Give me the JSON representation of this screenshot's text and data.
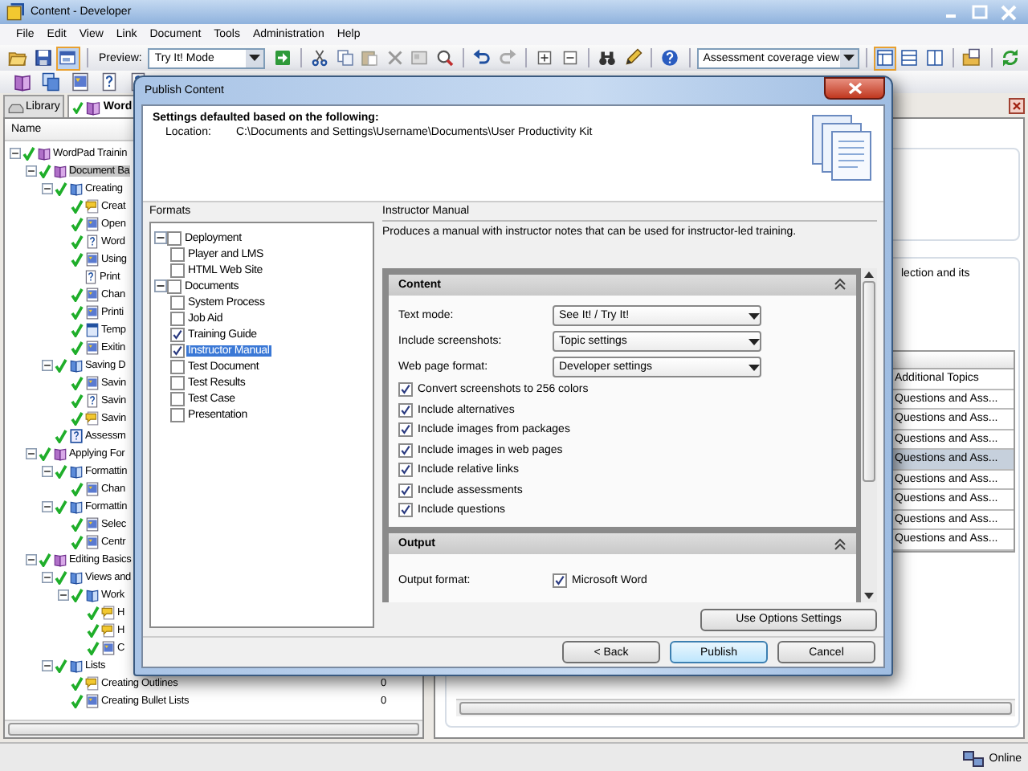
{
  "window": {
    "title": "Content - Developer"
  },
  "menu": [
    {
      "label": "File"
    },
    {
      "label": "Edit"
    },
    {
      "label": "View"
    },
    {
      "label": "Link"
    },
    {
      "label": "Document"
    },
    {
      "label": "Tools"
    },
    {
      "label": "Administration"
    },
    {
      "label": "Help"
    }
  ],
  "toolbar": {
    "file_buttons": [
      {
        "kind": "open",
        "pressed": false
      },
      {
        "kind": "save",
        "pressed": false
      },
      {
        "kind": "publish",
        "pressed": true
      }
    ],
    "preview": {
      "label": "Preview:",
      "value": "Try It! Mode"
    },
    "tool_groups": [
      [
        {
          "kind": "go",
          "pressed": false
        }
      ],
      [
        {
          "kind": "cut",
          "pressed": false
        },
        {
          "kind": "copy",
          "pressed": false
        },
        {
          "kind": "paste",
          "pressed": false
        },
        {
          "kind": "del",
          "pressed": false
        },
        {
          "kind": "props",
          "pressed": false
        },
        {
          "kind": "find",
          "pressed": false
        }
      ],
      [
        {
          "kind": "undo",
          "pressed": false
        },
        {
          "kind": "redo",
          "pressed": false
        }
      ],
      [
        {
          "kind": "plus",
          "pressed": false
        },
        {
          "kind": "minus",
          "pressed": false
        }
      ],
      [
        {
          "kind": "binoc",
          "pressed": false
        },
        {
          "kind": "spell",
          "pressed": false
        }
      ],
      [
        {
          "kind": "help",
          "pressed": false
        }
      ]
    ],
    "view_select": "Assessment coverage view",
    "view_groups": [
      [
        {
          "kind": "v1",
          "pressed": true
        },
        {
          "kind": "v2",
          "pressed": false
        },
        {
          "kind": "v3",
          "pressed": false
        }
      ],
      [
        {
          "kind": "props2",
          "pressed": false
        }
      ],
      [
        {
          "kind": "refresh",
          "pressed": false
        }
      ]
    ]
  },
  "toolbar2": [
    {
      "kind": "module"
    },
    {
      "kind": "stack"
    },
    {
      "kind": "screen"
    },
    {
      "kind": "question"
    },
    {
      "kind": "question"
    }
  ],
  "tabs": [
    {
      "label": "Library",
      "kind": "library",
      "selected": false
    },
    {
      "label": "Word",
      "kind": "document",
      "selected": true
    }
  ],
  "library": {
    "column": "Name",
    "tree": [
      {
        "label": "WordPad Trainin",
        "kind": "module",
        "checked": true,
        "selected": false,
        "expanded": true,
        "children": [
          {
            "label": "Document Ba",
            "kind": "module",
            "checked": true,
            "selected": true,
            "expanded": true,
            "children": [
              {
                "label": "Creating",
                "kind": "section",
                "checked": true,
                "selected": false,
                "expanded": true,
                "children": [
                  {
                    "label": "Creat",
                    "kind": "topic",
                    "checked": true,
                    "selected": false
                  },
                  {
                    "label": "Open",
                    "kind": "screen",
                    "checked": true,
                    "selected": false
                  },
                  {
                    "label": "Word",
                    "kind": "question",
                    "checked": true,
                    "selected": false
                  },
                  {
                    "label": "Using",
                    "kind": "screen",
                    "checked": true,
                    "selected": false
                  },
                  {
                    "label": "Print",
                    "kind": "question",
                    "checked": false,
                    "selected": false
                  },
                  {
                    "label": "Chan",
                    "kind": "screen",
                    "checked": true,
                    "selected": false
                  },
                  {
                    "label": "Printi",
                    "kind": "screen",
                    "checked": true,
                    "selected": false
                  },
                  {
                    "label": "Temp",
                    "kind": "web",
                    "checked": true,
                    "selected": false
                  },
                  {
                    "label": "Exitin",
                    "kind": "screen",
                    "checked": true,
                    "selected": false
                  }
                ]
              },
              {
                "label": "Saving D",
                "kind": "section",
                "checked": true,
                "selected": false,
                "expanded": true,
                "children": [
                  {
                    "label": "Savin",
                    "kind": "screen",
                    "checked": true,
                    "selected": false
                  },
                  {
                    "label": "Savin",
                    "kind": "question",
                    "checked": true,
                    "selected": false
                  },
                  {
                    "label": "Savin",
                    "kind": "topic",
                    "checked": true,
                    "selected": false
                  }
                ]
              },
              {
                "label": "Assessm",
                "kind": "assessment",
                "checked": true,
                "selected": false
              }
            ]
          },
          {
            "label": "Applying For",
            "kind": "module",
            "checked": true,
            "selected": false,
            "expanded": true,
            "children": [
              {
                "label": "Formattin",
                "kind": "section",
                "checked": true,
                "selected": false,
                "expanded": true,
                "children": [
                  {
                    "label": "Chan",
                    "kind": "screen",
                    "checked": true,
                    "selected": false
                  }
                ]
              },
              {
                "label": "Formattin",
                "kind": "section",
                "checked": true,
                "selected": false,
                "expanded": true,
                "children": [
                  {
                    "label": "Selec",
                    "kind": "screen",
                    "checked": true,
                    "selected": false
                  },
                  {
                    "label": "Centr",
                    "kind": "screen",
                    "checked": true,
                    "selected": false
                  }
                ]
              }
            ]
          },
          {
            "label": "Editing Basics",
            "kind": "module",
            "checked": true,
            "selected": false,
            "expanded": true,
            "children": [
              {
                "label": "Views and",
                "kind": "section",
                "checked": true,
                "selected": false,
                "expanded": true,
                "children": [
                  {
                    "label": "Work",
                    "kind": "section",
                    "checked": true,
                    "selected": false,
                    "expanded": true,
                    "children": [
                      {
                        "label": "H",
                        "kind": "topic",
                        "checked": true,
                        "selected": false
                      },
                      {
                        "label": "H",
                        "kind": "topic",
                        "checked": true,
                        "selected": false
                      },
                      {
                        "label": "C",
                        "kind": "screen",
                        "checked": true,
                        "selected": false
                      }
                    ]
                  }
                ]
              },
              {
                "label": "Lists",
                "kind": "section",
                "checked": true,
                "selected": false,
                "expanded": true,
                "children": [
                  {
                    "label": "Creating Outlines",
                    "kind": "topic",
                    "checked": true,
                    "selected": false,
                    "count": "0"
                  },
                  {
                    "label": "Creating Bullet Lists",
                    "kind": "screen",
                    "checked": true,
                    "selected": false,
                    "count": "0"
                  }
                ]
              }
            ]
          }
        ]
      }
    ]
  },
  "details": {
    "text": "lection and its",
    "column_header": "Additional Topics",
    "rows": [
      {
        "cell": "Questions and Ass...",
        "selected": false
      },
      {
        "cell": "Questions and Ass...",
        "selected": false
      },
      {
        "cell": "Questions and Ass...",
        "selected": false
      },
      {
        "cell": "Questions and Ass...",
        "selected": true
      },
      {
        "cell": "Questions and Ass...",
        "selected": false
      },
      {
        "cell": "Questions and Ass...",
        "selected": false
      },
      {
        "cell": "Questions and Ass...",
        "selected": false
      },
      {
        "cell": "Questions and Ass...",
        "selected": false
      }
    ]
  },
  "dialog": {
    "title": "Publish Content",
    "heading": "Settings defaulted based on the following:",
    "location_label": "Location:",
    "location": "C:\\Documents and Settings\\Username\\Documents\\User Productivity Kit",
    "formats_label": "Formats",
    "formats": [
      {
        "label": "Deployment",
        "checked": false,
        "selected": false,
        "expanded": true,
        "children": [
          {
            "label": "Player and LMS",
            "checked": false,
            "selected": false
          },
          {
            "label": "HTML Web Site",
            "checked": false,
            "selected": false
          }
        ]
      },
      {
        "label": "Documents",
        "checked": false,
        "selected": false,
        "expanded": true,
        "children": [
          {
            "label": "System Process",
            "checked": false,
            "selected": false
          },
          {
            "label": "Job Aid",
            "checked": false,
            "selected": false
          },
          {
            "label": "Training Guide",
            "checked": true,
            "selected": false
          },
          {
            "label": "Instructor Manual",
            "checked": true,
            "selected": true
          },
          {
            "label": "Test Document",
            "checked": false,
            "selected": false
          },
          {
            "label": "Test Results",
            "checked": false,
            "selected": false
          },
          {
            "label": "Test Case",
            "checked": false,
            "selected": false
          },
          {
            "label": "Presentation",
            "checked": false,
            "selected": false
          }
        ]
      }
    ],
    "format_title": "Instructor Manual",
    "description": "Produces a manual with instructor notes that can be used for instructor-led training.",
    "sections": [
      {
        "title": "Content",
        "expanded": true,
        "fields": [
          {
            "kind": "select",
            "label": "Text mode:",
            "value": "See It! / Try It!"
          },
          {
            "kind": "select",
            "label": "Include screenshots:",
            "value": "Topic settings"
          },
          {
            "kind": "select",
            "label": "Web page format:",
            "value": "Developer settings"
          },
          {
            "kind": "checkbox",
            "label": "Convert screenshots to 256 colors",
            "checked": true
          },
          {
            "kind": "checkbox",
            "label": "Include alternatives",
            "checked": true
          },
          {
            "kind": "checkbox",
            "label": "Include images from packages",
            "checked": true
          },
          {
            "kind": "checkbox",
            "label": "Include images in web pages",
            "checked": true
          },
          {
            "kind": "checkbox",
            "label": "Include relative links",
            "checked": true
          },
          {
            "kind": "checkbox",
            "label": "Include assessments",
            "checked": true
          },
          {
            "kind": "checkbox",
            "label": "Include questions",
            "checked": true
          }
        ]
      },
      {
        "title": "Output",
        "expanded": true,
        "fields": [
          {
            "kind": "labeled_checkbox",
            "label": "Output format:",
            "value": "Microsoft Word",
            "checked": true
          }
        ]
      }
    ],
    "options_button": "Use Options Settings",
    "buttons": [
      {
        "label": "< Back",
        "default": false
      },
      {
        "label": "Publish",
        "default": true
      },
      {
        "label": "Cancel",
        "default": false
      }
    ]
  },
  "status_bar": {
    "text": "Online"
  }
}
